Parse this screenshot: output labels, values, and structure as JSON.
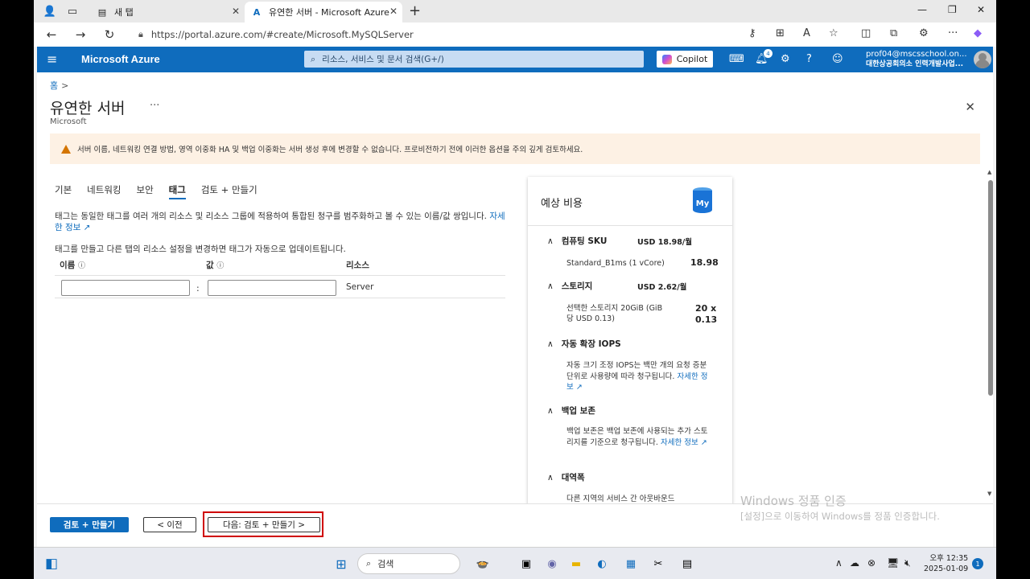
{
  "browser": {
    "tabs": [
      {
        "label": "새 탭"
      },
      {
        "label": "유연한 서버 - Microsoft Azure"
      }
    ],
    "url": "https://portal.azure.com/#create/Microsoft.MySQLServer"
  },
  "azure": {
    "brand": "Microsoft Azure",
    "search_placeholder": "리소스, 서비스 및 문서 검색(G+/)",
    "copilot_label": "Copilot",
    "notification_count": "4",
    "account_email": "prof04@mscsschool.on...",
    "account_org": "대한상공회의소 인력개발사업..."
  },
  "page": {
    "breadcrumb_home": "홈",
    "breadcrumb_sep": ">",
    "title": "유연한 서버",
    "more": "···",
    "subtitle": "Microsoft",
    "warning": "서버 이름, 네트워킹 연결 방법, 영역 이중화 HA 및 백업 이중화는 서버 생성 후에 변경할 수 없습니다. 프로비전하기 전에 이러한 옵션을 주의 깊게 검토하세요.",
    "tabs": [
      "기본",
      "네트워킹",
      "보안",
      "태그",
      "검토 + 만들기"
    ],
    "selected_tab": "태그",
    "desc1": "태그는 동일한 태그를 여러 개의 리소스 및 리소스 그룹에 적용하여 통합된 청구를 범주화하고 볼 수 있는 이름/값 쌍입니다.",
    "desc1_link": "자세한 정보",
    "desc2": "태그를 만들고 다른 탭의 리소스 설정을 변경하면 태그가 자동으로 업데이트됩니다.",
    "table": {
      "col_name": "이름",
      "col_value": "값",
      "col_resource": "리소스",
      "colon": ":",
      "resource_value": "Server",
      "name_value": "",
      "value_value": ""
    }
  },
  "cost": {
    "title": "예상 비용",
    "compute_label": "컴퓨팅 SKU",
    "compute_price": "USD 18.98/월",
    "compute_item": "Standard_B1ms (1 vCore)",
    "compute_item_value": "18.98",
    "storage_label": "스토리지",
    "storage_price": "USD 2.62/월",
    "storage_item_l1": "선택한 스토리지",
    "storage_item_l1b": "20GiB (GiB",
    "storage_item_l2": "당 USD 0.13)",
    "storage_value_l1": "20 x",
    "storage_value_l2": "0.13",
    "iops_label": "자동 확장 IOPS",
    "iops_text": "자동 크기 조정 IOPS는 백만 개의 요청 증분 단위로 사용량에 따라 청구됩니다.",
    "iops_link": "자세한 정보",
    "backup_label": "백업 보존",
    "backup_text": "백업 보존은 백업 보존에 사용되는 추가 스토리지를 기준으로 청구됩니다.",
    "backup_link": "자세한 정보",
    "bandwidth_label": "대역폭",
    "bandwidth_text": "다른 지역의 서비스 간 아웃바운드"
  },
  "footer": {
    "review_create": "검토 + 만들기",
    "previous": "< 이전",
    "next": "다음: 검토 + 만들기 >"
  },
  "watermark": {
    "line1": "Windows 정품 인증",
    "line2": "[설정]으로 이동하여 Windows를 정품 인증합니다."
  },
  "taskbar": {
    "search": "검색",
    "time": "오후 12:35",
    "date": "2025-01-09",
    "notif": "1"
  },
  "colors": {
    "azure_blue": "#0f6cbd",
    "warning_bg": "#fdf1e4",
    "highlight_red": "#d00000"
  }
}
